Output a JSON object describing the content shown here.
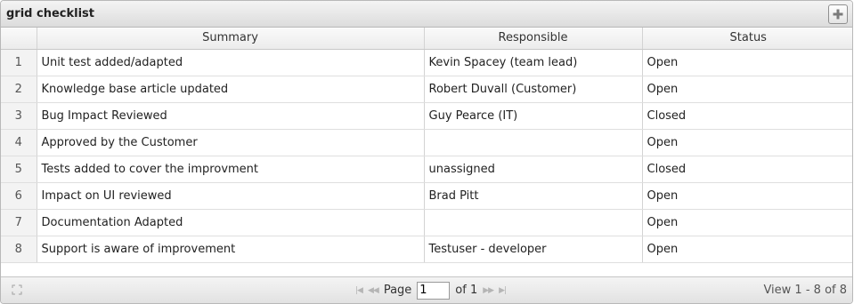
{
  "grid": {
    "title": "grid checklist",
    "columns": [
      "",
      "Summary",
      "Responsible",
      "Status"
    ],
    "rows": [
      {
        "num": "1",
        "summary": "Unit test added/adapted",
        "responsible": "Kevin Spacey (team lead)",
        "status": "Open"
      },
      {
        "num": "2",
        "summary": "Knowledge base article updated",
        "responsible": "Robert Duvall (Customer)",
        "status": "Open"
      },
      {
        "num": "3",
        "summary": "Bug Impact Reviewed",
        "responsible": "Guy Pearce (IT)",
        "status": "Closed"
      },
      {
        "num": "4",
        "summary": "Approved by the Customer",
        "responsible": "",
        "status": "Open"
      },
      {
        "num": "5",
        "summary": "Tests added to cover the improvment",
        "responsible": "unassigned",
        "status": "Closed"
      },
      {
        "num": "6",
        "summary": "Impact on UI reviewed",
        "responsible": "Brad Pitt",
        "status": "Open"
      },
      {
        "num": "7",
        "summary": "Documentation Adapted",
        "responsible": "",
        "status": "Open"
      },
      {
        "num": "8",
        "summary": "Support is aware of improvement",
        "responsible": "Testuser - developer",
        "status": "Open"
      }
    ]
  },
  "pager": {
    "page_label": "Page",
    "page_value": "1",
    "of_label": "of 1",
    "view_info": "View 1 - 8 of 8"
  },
  "icons": {
    "add": "plus-icon",
    "resize": "expand-icon",
    "first": "first-page-icon",
    "prev": "prev-page-icon",
    "next": "next-page-icon",
    "last": "last-page-icon"
  }
}
